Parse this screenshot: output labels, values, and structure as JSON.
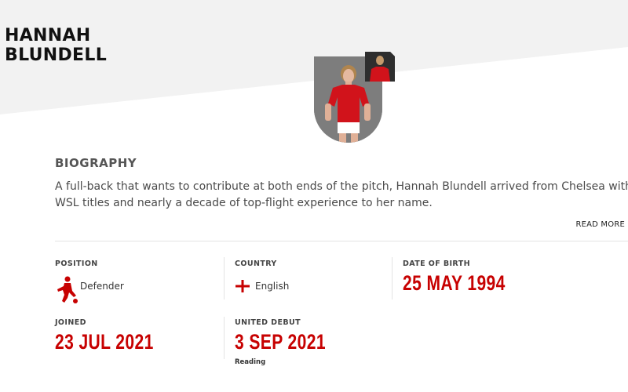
{
  "player": {
    "first_name": "HANNAH",
    "last_name": "BLUNDELL"
  },
  "biography": {
    "title": "BIOGRAPHY",
    "line1": "A full-back that wants to contribute at both ends of the pitch, Hannah Blundell arrived from Chelsea with four",
    "line2": "WSL titles and nearly a decade of top-flight experience to her name.",
    "read_more": "READ MORE"
  },
  "stats": {
    "position": {
      "label": "POSITION",
      "value": "Defender",
      "icon": "footballer-icon"
    },
    "country": {
      "label": "COUNTRY",
      "value": "English",
      "icon": "england-flag-icon"
    },
    "date_of_birth": {
      "label": "DATE OF BIRTH",
      "value": "25 MAY 1994"
    },
    "joined": {
      "label": "JOINED",
      "value": "23 JUL 2021"
    },
    "united_debut": {
      "label": "UNITED DEBUT",
      "value": "3 SEP 2021",
      "note": "Reading"
    }
  },
  "colors": {
    "accent_red": "#c70101",
    "header_grey": "#f2f2f2",
    "text_dark": "#111111"
  }
}
